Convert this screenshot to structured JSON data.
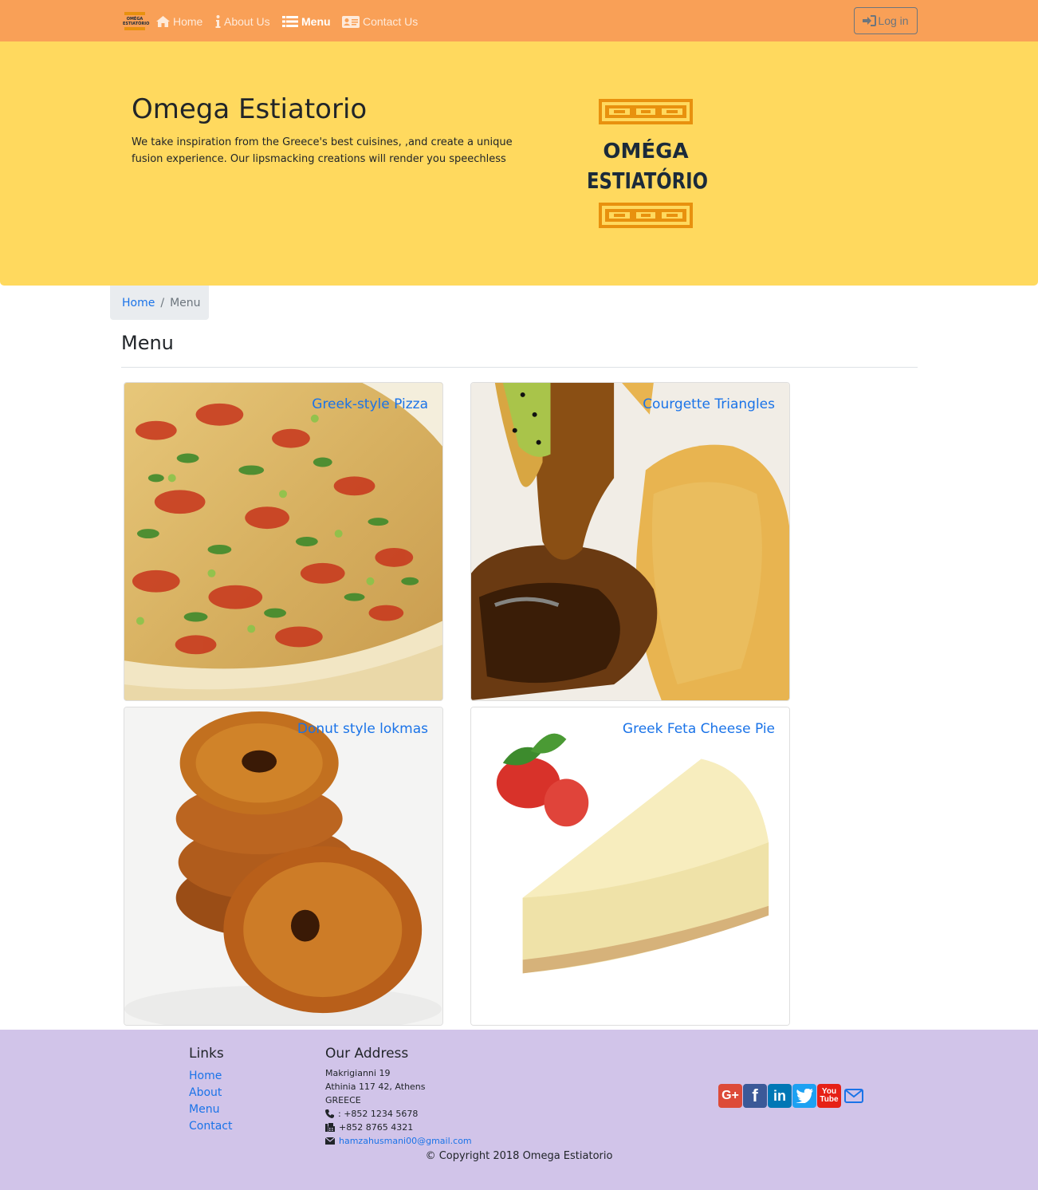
{
  "brand": {
    "logo_text": "OMÉGA ESTIATÓRIO"
  },
  "nav": {
    "items": [
      {
        "label": "Home",
        "icon": "home-icon"
      },
      {
        "label": "About Us",
        "icon": "info-icon"
      },
      {
        "label": "Menu",
        "icon": "list-icon",
        "active": true
      },
      {
        "label": "Contact Us",
        "icon": "address-card-icon"
      }
    ],
    "login_label": "Log in"
  },
  "jumbotron": {
    "title": "Omega Estiatorio",
    "text": "We take inspiration from the Greece's best cuisines, ,and create a unique fusion experience. Our lipsmacking creations will render you speechless",
    "logo_line1": "OMÉGA",
    "logo_line2": "ESTIATÓRIO"
  },
  "breadcrumb": {
    "home": "Home",
    "current": "Menu"
  },
  "page": {
    "title": "Menu"
  },
  "dishes": [
    {
      "name": "Greek-style Pizza"
    },
    {
      "name": "Courgette Triangles"
    },
    {
      "name": "Donut style lokmas"
    },
    {
      "name": "Greek Feta Cheese Pie"
    }
  ],
  "footer": {
    "links_heading": "Links",
    "links": [
      "Home",
      "About",
      "Menu",
      "Contact"
    ],
    "address_heading": "Our Address",
    "address_lines": [
      "Makrigianni 19",
      "Athinia 117 42, Athens",
      "GREECE"
    ],
    "phone": ": +852 1234 5678",
    "fax": "+852 8765 4321",
    "email": "hamzahusmani00@gmail.com",
    "social": [
      "google-plus",
      "facebook",
      "linkedin",
      "twitter",
      "youtube",
      "mail"
    ],
    "copyright": "© Copyright 2018 Omega Estiatorio"
  },
  "colors": {
    "navbar": "#f9a057",
    "jumbotron": "#ffd95e",
    "footer": "#d1c4e9",
    "link": "#1a73e8"
  }
}
